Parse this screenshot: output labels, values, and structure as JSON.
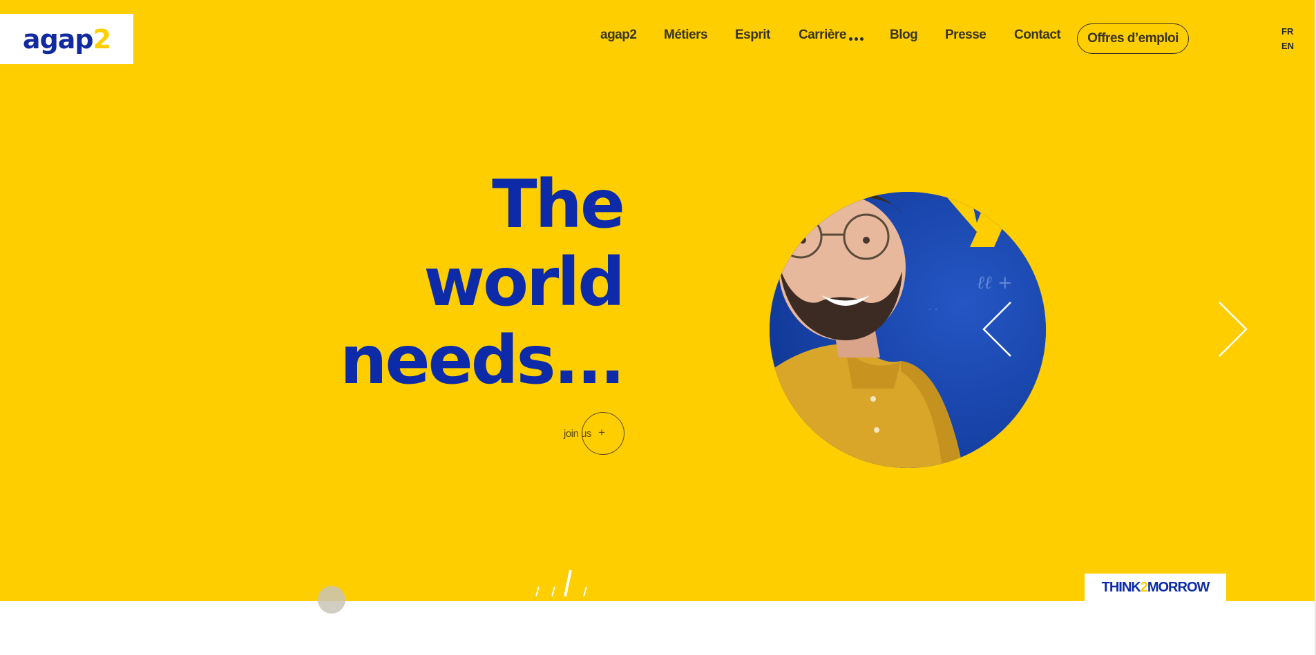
{
  "brand": {
    "logo_main": "agap",
    "logo_accent": "2",
    "accent_color": "#FECE00",
    "brand_blue": "#0D2BA8"
  },
  "nav": {
    "items": [
      {
        "label": "agap2"
      },
      {
        "label": "Métiers"
      },
      {
        "label": "Esprit"
      },
      {
        "label": "Carrière"
      },
      {
        "label": "Blog"
      },
      {
        "label": "Presse"
      },
      {
        "label": "Contact"
      }
    ],
    "cta_label": "Offres d’emploi",
    "lang": [
      "FR",
      "EN"
    ]
  },
  "hero": {
    "headline": [
      "The",
      "world",
      "needs..."
    ],
    "join_label": "join us",
    "join_icon": "plus-icon",
    "carousel_prev_icon": "chevron-left-icon",
    "carousel_next_icon": "chevron-right-icon"
  },
  "footer_badge": {
    "think": "THINK",
    "two": "2",
    "morrow": "MORROW"
  }
}
